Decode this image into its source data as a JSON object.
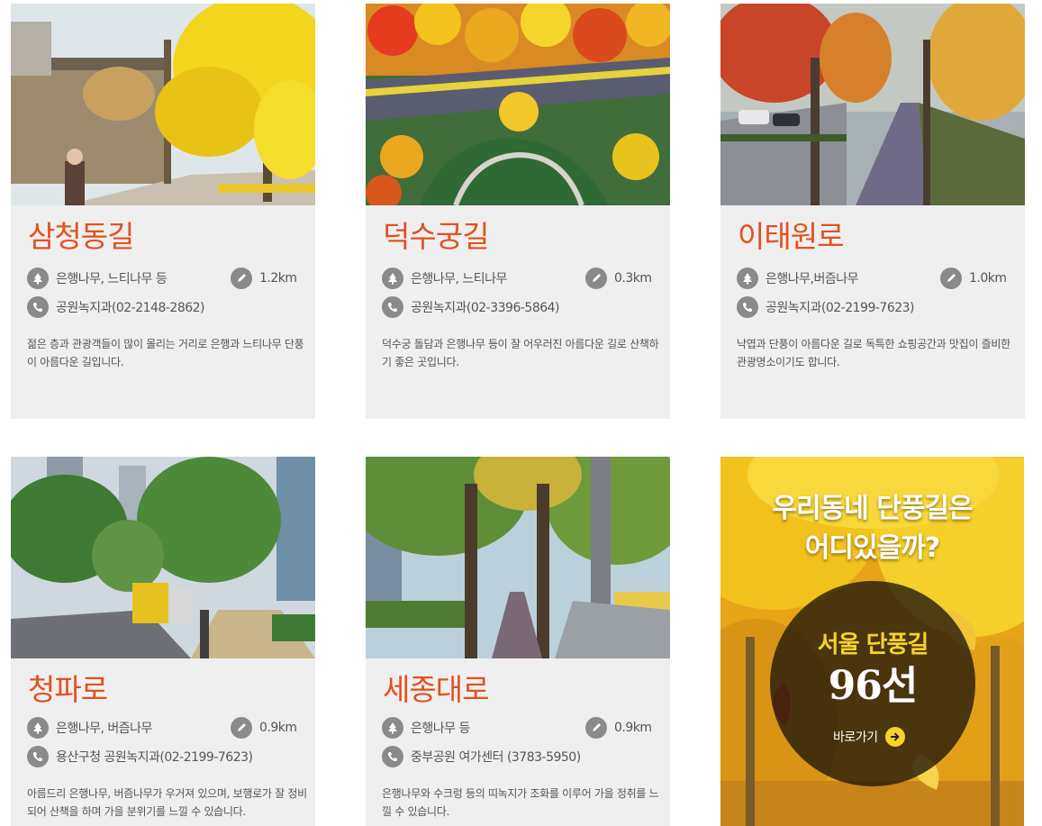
{
  "cards": [
    {
      "title": "삼청동길",
      "trees": "은행나무, 느티나무 등",
      "distance": "1.2km",
      "contact": "공원녹지과(02-2148-2862)",
      "description": "젊은 층과 관광객들이 많이 몰리는 거리로 은행과 느티나무 단풍이 아름다운 길입니다."
    },
    {
      "title": "덕수궁길",
      "trees": "은행나무, 느티나무",
      "distance": "0.3km",
      "contact": "공원녹지과(02-3396-5864)",
      "description": "덕수궁 돌담과 은행나무 등이 잘 어우러진 아름다운 길로 산책하기 좋은 곳입니다."
    },
    {
      "title": "이태원로",
      "trees": "은행나무,버즘나무",
      "distance": "1.0km",
      "contact": "공원녹지과(02-2199-7623)",
      "description": "낙엽과 단풍이 아름다운 길로 독특한 쇼핑공간과 맛집이 즐비한 관광명소이기도 합니다."
    },
    {
      "title": "청파로",
      "trees": "은행나무, 버즘나무",
      "distance": "0.9km",
      "contact": "용산구청 공원녹지과(02-2199-7623)",
      "description": "아름드리 은행나무, 버즘나무가 우거져 있으며, 보행로가 잘 정비되어 산책을 하며 가을 분위기를 느낄 수 있습니다."
    },
    {
      "title": "세종대로",
      "trees": "은행나무 등",
      "distance": "0.9km",
      "contact": "중부공원 여가센터 (3783-5950)",
      "description": "은행나무와 수크렁 등의 띠녹지가 조화를 이루어 가을 정취를 느낄 수 있습니다."
    }
  ],
  "promo": {
    "headline_1": "우리동네 단풍길은",
    "headline_2": "어디있을까?",
    "subtitle": "서울 단풍길",
    "count": "96선",
    "link_label": "바로가기"
  },
  "icons": {
    "tree": "tree-icon",
    "distance": "pencil-icon",
    "phone": "phone-icon",
    "go": "arrow-right-icon"
  },
  "colors": {
    "title": "#e2511f",
    "card_bg": "#efefef",
    "icon_bg": "#8a8a8a",
    "promo_accent": "#f6d22a"
  }
}
